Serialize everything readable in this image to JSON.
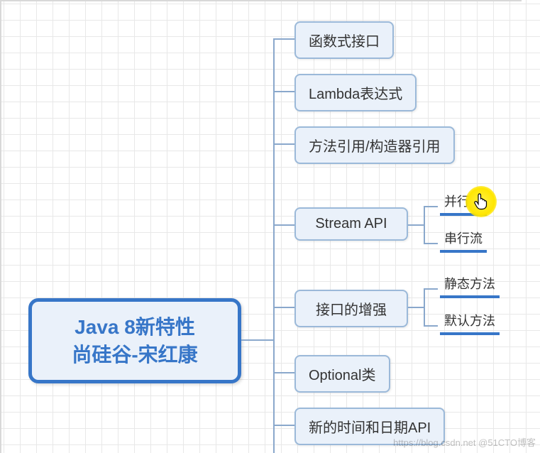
{
  "root": {
    "line1": "Java 8新特性",
    "line2": "尚硅谷-宋红康"
  },
  "children": [
    {
      "label": "函数式接口"
    },
    {
      "label": "Lambda表达式"
    },
    {
      "label": "方法引用/构造器引用"
    },
    {
      "label": "Stream API",
      "leaves": [
        "并行流",
        "串行流"
      ]
    },
    {
      "label": "接口的增强",
      "leaves": [
        "静态方法",
        "默认方法"
      ]
    },
    {
      "label": "Optional类"
    },
    {
      "label": "新的时间和日期API"
    }
  ],
  "watermark": "https://blog.csdn.net @51CTO博客"
}
